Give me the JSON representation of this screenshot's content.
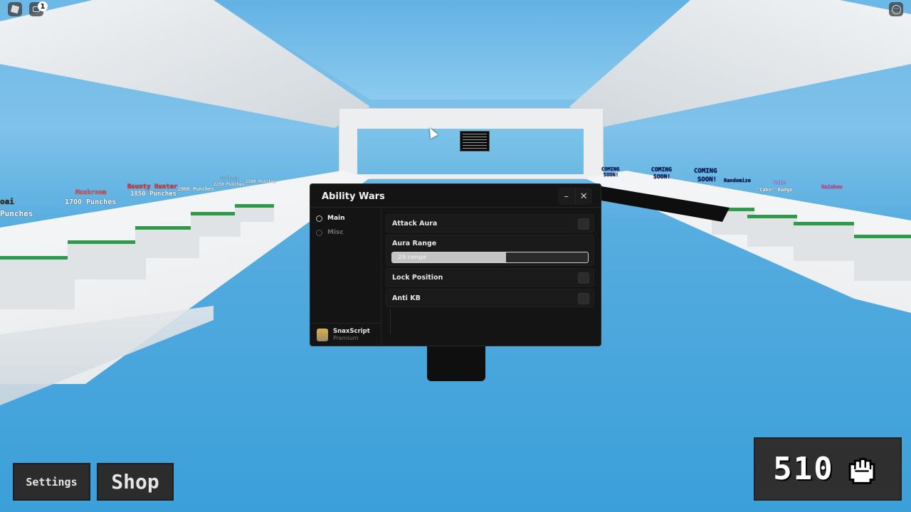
{
  "topbar": {
    "roblox_menu_icon": "roblox-logo-icon",
    "chat_icon": "chat-icon",
    "chat_badge_count": "1",
    "more_icon": "more-options-icon"
  },
  "scene": {
    "left_labels": [
      {
        "text": "oai",
        "color": "#3a2a10"
      },
      {
        "text": "Punches",
        "color": "#ffffff"
      },
      {
        "text": "1700 Punches",
        "color": "#ffffff"
      },
      {
        "text": "Mushroom",
        "color": "#ff5a5a"
      },
      {
        "text": "Bounty Hunter",
        "color": "#ff3030"
      },
      {
        "text": "1850 Punches",
        "color": "#ffffff"
      },
      {
        "text": "2000 Punches",
        "color": "#ffffff"
      },
      {
        "text": "2250 Punches",
        "color": "#ffffff"
      },
      {
        "text": "Deflect",
        "color": "#9fd8ff"
      },
      {
        "text": "2500 Punches",
        "color": "#ffffff"
      }
    ],
    "right_labels": [
      {
        "text": "COMING",
        "color": "#0b1c66"
      },
      {
        "text": "SOON!",
        "color": "#0b1c66"
      },
      {
        "text": "COMING",
        "color": "#0b1c66"
      },
      {
        "text": "SOON!",
        "color": "#0b1c66"
      },
      {
        "text": "COMING",
        "color": "#0b1c66"
      },
      {
        "text": "SOON!",
        "color": "#0b1c66"
      },
      {
        "text": "Randomize",
        "color": "#0b1c66"
      },
      {
        "text": "Cake",
        "color": "#c9a0ff"
      },
      {
        "text": "\"Cake\" Badge",
        "color": "#ffffff"
      },
      {
        "text": "Rainbow",
        "color": "#ff4fa0"
      }
    ]
  },
  "window": {
    "title": "Ability Wars",
    "minimize_label": "–",
    "close_label": "✕",
    "tabs": [
      {
        "label": "Main",
        "active": true
      },
      {
        "label": "Misc",
        "active": false
      }
    ],
    "profile": {
      "name": "SnaxScript",
      "tier": "Premium"
    },
    "options": {
      "attack_aura": {
        "label": "Attack Aura",
        "enabled": false
      },
      "aura_range": {
        "label": "Aura Range",
        "value_text": "20 range",
        "fill_fraction": 0.58
      },
      "lock_position": {
        "label": "Lock Position",
        "enabled": false
      },
      "anti_kb": {
        "label": "Anti KB",
        "enabled": false
      }
    }
  },
  "hud": {
    "settings_label": "Settings",
    "shop_label": "Shop",
    "punch_count": "510",
    "punch_icon": "fist-icon"
  }
}
